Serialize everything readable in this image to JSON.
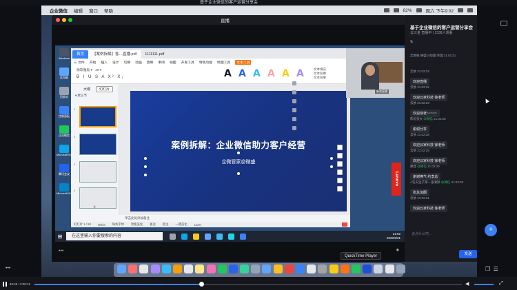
{
  "outer": {
    "title": "基于企业微信的客户运营分享会"
  },
  "menubar": {
    "app": "企业微信",
    "items": [
      "编辑",
      "窗口",
      "帮助"
    ],
    "battery": "82%",
    "datetime": "周六 下午9:02"
  },
  "live_window": {
    "title": "直播"
  },
  "desktop_icons": [
    {
      "label": "Windows",
      "color": "#4b5563"
    },
    {
      "label": "此电脑",
      "color": "#60a5fa"
    },
    {
      "label": "回收站",
      "color": "#9ca3af"
    },
    {
      "label": "控制面板",
      "color": "#3b82f6"
    },
    {
      "label": "企业微信",
      "color": "#22c55e"
    },
    {
      "label": "Microsoft Edge",
      "color": "#0ea5e9"
    },
    {
      "label": "腾讯会议",
      "color": "#2563eb"
    },
    {
      "label": "Microsoft Edge",
      "color": "#0284c7"
    }
  ],
  "wps": {
    "tabs": [
      "首页",
      "【案例拆解】客…直播.pdf",
      "1111111.pdf"
    ],
    "menu": [
      "三 文件",
      "开始",
      "插入",
      "设计",
      "切换",
      "动画",
      "放映",
      "审阅",
      "视图",
      "开发工具",
      "特色功能",
      "绘图工具",
      "文本工具"
    ],
    "active_menu": "文本工具",
    "font_name": "微软雅黑",
    "font_size": "48",
    "fmt_tools": "B I U S A X² X₂",
    "text_styles": [
      {
        "glyph": "A",
        "color": "#111827"
      },
      {
        "glyph": "A",
        "color": "#2563eb"
      },
      {
        "glyph": "A",
        "color": "#38bdf8"
      },
      {
        "glyph": "A",
        "color": "#fca5a5"
      },
      {
        "glyph": "A",
        "color": "#facc15"
      },
      {
        "glyph": "A",
        "color": "#a78bfa"
      }
    ],
    "ribbon_right": [
      "文本填充",
      "文本轮廓",
      "文本效果"
    ],
    "side_tabs": {
      "outline": "大纲",
      "slides": "幻灯片"
    },
    "side_sub": "▾ 默认节",
    "slide_title": "案例拆解：企业微信助力客户经营",
    "slide_subtitle": "企微管家@微盛",
    "notes": "单击此处添加备注",
    "status": [
      "幻灯片 1 / 58",
      "White",
      "缺失字体",
      "智能美化",
      "备注",
      "批注",
      "一键美化"
    ],
    "zoom": "112%"
  },
  "taskbar": {
    "search_placeholder": "在这里输入你要搜索的内容",
    "time": "21:02",
    "date": "2020/3/21"
  },
  "lenovo": "Lenovo",
  "camera": {
    "label": "新浪直播"
  },
  "chat": {
    "title": "基于企业微信的客户运营分享会",
    "subtitle": "云三金 直播中 | 1338人观看",
    "tag": "私",
    "messages": [
      {
        "name": "奔驰帆 微盛小助理 宗理",
        "time": "21:02:21",
        "body": "",
        "tag": ""
      },
      {
        "name": "云依",
        "time": "21:02:22",
        "body": "欢迎直播",
        "tag": ""
      },
      {
        "name": "云依",
        "time": "21:02:22",
        "body": "欢迎云家科技 徐老师",
        "tag": ""
      },
      {
        "name": "云依",
        "time": "21:02:23",
        "body": "欢迎徐老~~~~~",
        "tag": ""
      },
      {
        "name": "陈松张文",
        "time": "21:02:25",
        "body": "谢谢分享",
        "tag": "@微信"
      },
      {
        "name": "云依",
        "time": "21:02:28",
        "body": "欢迎云家科技 徐老师",
        "tag": ""
      },
      {
        "name": "云依",
        "time": "21:02:29",
        "body": "欢迎云家科技 徐老师",
        "tag": ""
      },
      {
        "name": "顾佳",
        "time": "21:02:29",
        "body": "谢谢捧气 约李总",
        "tag": "@微信"
      },
      {
        "name": "A包天生子第一张清除",
        "time": "21:02:30",
        "body": "张总加酮",
        "tag": "@微信"
      },
      {
        "name": "云依",
        "time": "21:02:31",
        "body": "欢迎云家科技 徐老师",
        "tag": ""
      }
    ],
    "input_placeholder": "说点什么吧...",
    "send": "发送"
  },
  "dock": {
    "tooltip": "QuickTime Player",
    "icons": [
      "#60a5fa",
      "#f87171",
      "#e5e7eb",
      "#a78bfa",
      "#38bdf8",
      "#f59e0b",
      "#e5e7eb",
      "#fde68a",
      "#f472b6",
      "#22c55e",
      "#2563eb",
      "#34d399",
      "#94a3b8",
      "#60a5fa",
      "#fbbf24",
      "#ef4444",
      "#3b82f6",
      "#e5e7eb",
      "#a3a3a3",
      "#facc15",
      "#f97316",
      "#22c55e",
      "#1d4ed8",
      "#cbd5e1",
      "#e5e7eb",
      "#94a3b8"
    ]
  },
  "player": {
    "time": "46:46 / 2:00:12",
    "progress": 0.39
  }
}
